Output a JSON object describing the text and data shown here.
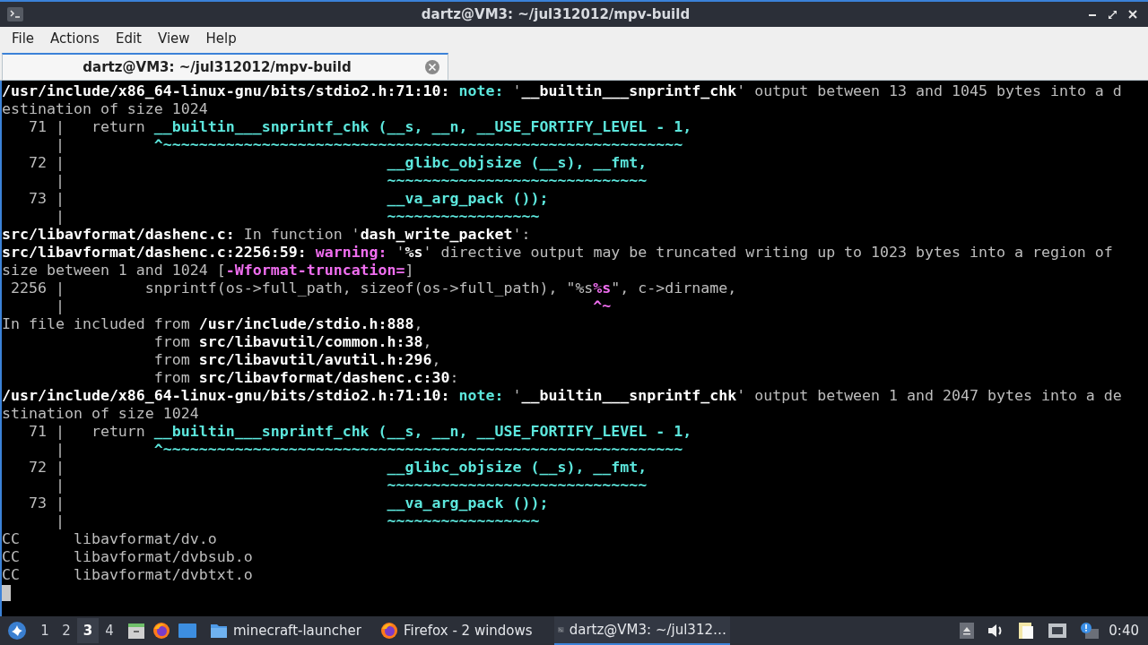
{
  "window": {
    "title": "dartz@VM3: ~/jul312012/mpv-build"
  },
  "menu": [
    "File",
    "Actions",
    "Edit",
    "View",
    "Help"
  ],
  "tabs": [
    {
      "title": "dartz@VM3: ~/jul312012/mpv-build",
      "selected": true
    }
  ],
  "terminal": {
    "cursor_visible": true,
    "lines": [
      {
        "segments": [
          {
            "kind": "bold",
            "text": "/usr/include/x86_64-linux-gnu/bits/stdio2.h:71:10: "
          },
          {
            "kind": "highlight",
            "text": "note: "
          },
          {
            "kind": "text",
            "text": "'"
          },
          {
            "kind": "bold",
            "text": "__builtin___snprintf_chk"
          },
          {
            "kind": "text",
            "text": "' output between 13 and 1045 bytes into a d"
          }
        ]
      },
      {
        "segments": [
          {
            "kind": "text",
            "text": "estination of size 1024"
          }
        ]
      },
      {
        "segments": [
          {
            "kind": "text",
            "text": "   71 |   return "
          },
          {
            "kind": "highlight",
            "text": "__builtin___snprintf_chk (__s, __n, __USE_FORTIFY_LEVEL - 1,"
          }
        ]
      },
      {
        "segments": [
          {
            "kind": "text",
            "text": "      |          "
          },
          {
            "kind": "highlight",
            "text": "^~~~~~~~~~~~~~~~~~~~~~~~~~~~~~~~~~~~~~~~~~~~~~~~~~~~~~~~~~~"
          }
        ]
      },
      {
        "segments": [
          {
            "kind": "text",
            "text": "   72 |                                    "
          },
          {
            "kind": "highlight",
            "text": "__glibc_objsize (__s), __fmt,"
          }
        ]
      },
      {
        "segments": [
          {
            "kind": "text",
            "text": "      |                                    "
          },
          {
            "kind": "highlight",
            "text": "~~~~~~~~~~~~~~~~~~~~~~~~~~~~~"
          }
        ]
      },
      {
        "segments": [
          {
            "kind": "text",
            "text": "   73 |                                    "
          },
          {
            "kind": "highlight",
            "text": "__va_arg_pack ());"
          }
        ]
      },
      {
        "segments": [
          {
            "kind": "text",
            "text": "      |                                    "
          },
          {
            "kind": "highlight",
            "text": "~~~~~~~~~~~~~~~~~"
          }
        ]
      },
      {
        "segments": [
          {
            "kind": "bold",
            "text": "src/libavformat/dashenc.c:"
          },
          {
            "kind": "text",
            "text": " In function '"
          },
          {
            "kind": "bold",
            "text": "dash_write_packet"
          },
          {
            "kind": "text",
            "text": "':"
          }
        ]
      },
      {
        "segments": [
          {
            "kind": "bold",
            "text": "src/libavformat/dashenc.c:2256:59: "
          },
          {
            "kind": "warning",
            "text": "warning: "
          },
          {
            "kind": "text",
            "text": "'"
          },
          {
            "kind": "bold",
            "text": "%s"
          },
          {
            "kind": "text",
            "text": "' directive output may be truncated writing up to 1023 bytes into a region of"
          }
        ]
      },
      {
        "segments": [
          {
            "kind": "text",
            "text": "size between 1 and 1024 ["
          },
          {
            "kind": "warning",
            "text": "-Wformat-truncation="
          },
          {
            "kind": "text",
            "text": "]"
          }
        ]
      },
      {
        "segments": [
          {
            "kind": "text",
            "text": " 2256 |         snprintf(os->full_path, sizeof(os->full_path), \"%s"
          },
          {
            "kind": "warning",
            "text": "%s"
          },
          {
            "kind": "text",
            "text": "\", c->dirname,"
          }
        ]
      },
      {
        "segments": [
          {
            "kind": "text",
            "text": "      |                                                           "
          },
          {
            "kind": "warning",
            "text": "^~"
          }
        ]
      },
      {
        "segments": [
          {
            "kind": "text",
            "text": "In file included from "
          },
          {
            "kind": "bold",
            "text": "/usr/include/stdio.h:888"
          },
          {
            "kind": "text",
            "text": ","
          }
        ]
      },
      {
        "segments": [
          {
            "kind": "text",
            "text": "                 from "
          },
          {
            "kind": "bold",
            "text": "src/libavutil/common.h:38"
          },
          {
            "kind": "text",
            "text": ","
          }
        ]
      },
      {
        "segments": [
          {
            "kind": "text",
            "text": "                 from "
          },
          {
            "kind": "bold",
            "text": "src/libavutil/avutil.h:296"
          },
          {
            "kind": "text",
            "text": ","
          }
        ]
      },
      {
        "segments": [
          {
            "kind": "text",
            "text": "                 from "
          },
          {
            "kind": "bold",
            "text": "src/libavformat/dashenc.c:30"
          },
          {
            "kind": "text",
            "text": ":"
          }
        ]
      },
      {
        "segments": [
          {
            "kind": "bold",
            "text": "/usr/include/x86_64-linux-gnu/bits/stdio2.h:71:10: "
          },
          {
            "kind": "highlight",
            "text": "note: "
          },
          {
            "kind": "text",
            "text": "'"
          },
          {
            "kind": "bold",
            "text": "__builtin___snprintf_chk"
          },
          {
            "kind": "text",
            "text": "' output between 1 and 2047 bytes into a de"
          }
        ]
      },
      {
        "segments": [
          {
            "kind": "text",
            "text": "stination of size 1024"
          }
        ]
      },
      {
        "segments": [
          {
            "kind": "text",
            "text": "   71 |   return "
          },
          {
            "kind": "highlight",
            "text": "__builtin___snprintf_chk (__s, __n, __USE_FORTIFY_LEVEL - 1,"
          }
        ]
      },
      {
        "segments": [
          {
            "kind": "text",
            "text": "      |          "
          },
          {
            "kind": "highlight",
            "text": "^~~~~~~~~~~~~~~~~~~~~~~~~~~~~~~~~~~~~~~~~~~~~~~~~~~~~~~~~~~"
          }
        ]
      },
      {
        "segments": [
          {
            "kind": "text",
            "text": "   72 |                                    "
          },
          {
            "kind": "highlight",
            "text": "__glibc_objsize (__s), __fmt,"
          }
        ]
      },
      {
        "segments": [
          {
            "kind": "text",
            "text": "      |                                    "
          },
          {
            "kind": "highlight",
            "text": "~~~~~~~~~~~~~~~~~~~~~~~~~~~~~"
          }
        ]
      },
      {
        "segments": [
          {
            "kind": "text",
            "text": "   73 |                                    "
          },
          {
            "kind": "highlight",
            "text": "__va_arg_pack ());"
          }
        ]
      },
      {
        "segments": [
          {
            "kind": "text",
            "text": "      |                                    "
          },
          {
            "kind": "highlight",
            "text": "~~~~~~~~~~~~~~~~~"
          }
        ]
      },
      {
        "segments": [
          {
            "kind": "text",
            "text": "CC      libavformat/dv.o"
          }
        ]
      },
      {
        "segments": [
          {
            "kind": "text",
            "text": "CC      libavformat/dvbsub.o"
          }
        ]
      },
      {
        "segments": [
          {
            "kind": "text",
            "text": "CC      libavformat/dvbtxt.o"
          }
        ]
      }
    ]
  },
  "taskbar": {
    "workspaces": [
      {
        "label": "1",
        "selected": false
      },
      {
        "label": "2",
        "selected": false
      },
      {
        "label": "3",
        "selected": true
      },
      {
        "label": "4",
        "selected": false
      }
    ],
    "tasks": [
      {
        "kind": "folder",
        "label": "minecraft-launcher",
        "selected": false
      },
      {
        "kind": "firefox",
        "label": "Firefox - 2 windows",
        "selected": false
      },
      {
        "kind": "terminal",
        "label": "dartz@VM3: ~/jul312…",
        "selected": true
      }
    ],
    "clock": "0:40"
  }
}
